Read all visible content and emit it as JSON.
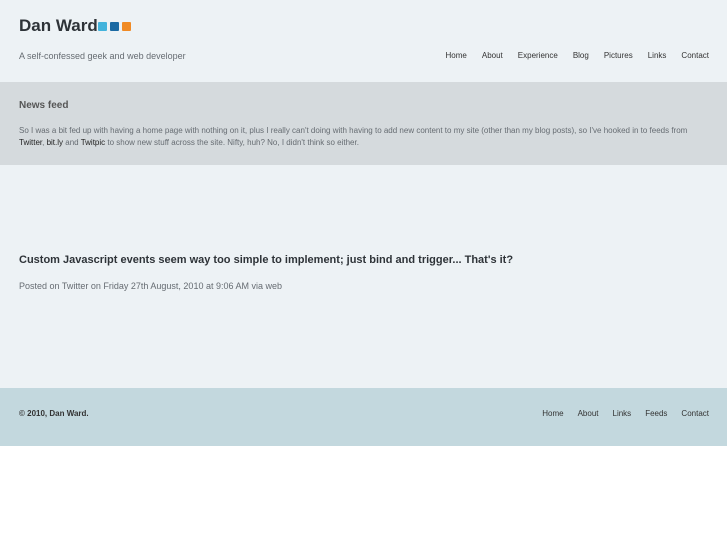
{
  "header": {
    "title": "Dan Ward",
    "tagline": "A self-confessed geek and web developer",
    "social_icons": [
      "twitter-icon",
      "linkedin-icon",
      "rss-icon"
    ],
    "nav": [
      "Home",
      "About",
      "Experience",
      "Blog",
      "Pictures",
      "Links",
      "Contact"
    ]
  },
  "feed": {
    "title": "News feed",
    "text_1": "So I was a bit fed up with having a home page with nothing on it, plus I really can't doing with having to add new content to my site (other than my blog posts), so I've hooked in to feeds from ",
    "link_twitter": "Twitter",
    "sep_1": ", ",
    "link_bitly": "bit.ly",
    "sep_2": " and ",
    "link_twitpic": "Twitpic",
    "text_2": " to show new stuff across the site. Nifty, huh? No, I didn't think so either."
  },
  "post": {
    "title": "Custom Javascript events seem way too simple to implement; just bind and trigger... That's it?",
    "meta": "Posted on Twitter on Friday 27th August, 2010 at 9:06 AM via web"
  },
  "footer": {
    "copyright": "© 2010, Dan Ward.",
    "nav": [
      "Home",
      "About",
      "Links",
      "Feeds",
      "Contact"
    ]
  },
  "colors": {
    "header_bg": "#edf2f5",
    "feed_bg": "#d5dadd",
    "footer_bg": "#c3d8de"
  }
}
